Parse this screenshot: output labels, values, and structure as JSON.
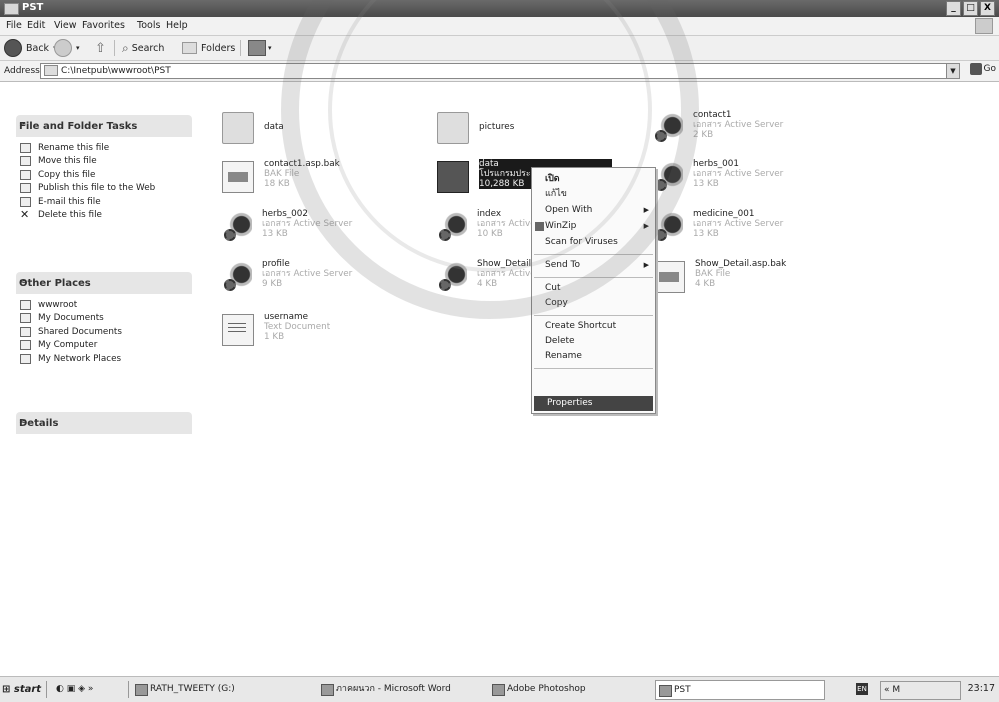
{
  "window": {
    "title": "PST",
    "min_label": "_",
    "max_label": "□",
    "close_label": "X"
  },
  "menubar": {
    "items": [
      "File",
      "Edit",
      "View",
      "Favorites",
      "Tools",
      "Help"
    ]
  },
  "toolbar": {
    "back_label": "Back",
    "search_label": "Search",
    "folders_label": "Folders"
  },
  "address": {
    "label": "Address",
    "value": "C:\\Inetpub\\wwwroot\\PST",
    "go_label": "Go"
  },
  "tasks_panel": {
    "title": "File and Folder Tasks",
    "items": [
      {
        "label": "Rename this file",
        "icon": "rename-icon"
      },
      {
        "label": "Move this file",
        "icon": "move-icon"
      },
      {
        "label": "Copy this file",
        "icon": "copy-icon"
      },
      {
        "label": "Publish this file to the Web",
        "icon": "publish-icon"
      },
      {
        "label": "E-mail this file",
        "icon": "email-icon"
      },
      {
        "label": "Delete this file",
        "icon": "delete-icon"
      }
    ]
  },
  "places_panel": {
    "title": "Other Places",
    "items": [
      {
        "label": "wwwroot",
        "icon": "folder-icon"
      },
      {
        "label": "My Documents",
        "icon": "folder-icon"
      },
      {
        "label": "Shared Documents",
        "icon": "folder-icon"
      },
      {
        "label": "My Computer",
        "icon": "computer-icon"
      },
      {
        "label": "My Network Places",
        "icon": "network-icon"
      }
    ]
  },
  "details_panel": {
    "title": "Details"
  },
  "files": [
    {
      "name": "data",
      "type": "",
      "size": "",
      "icon": "folder"
    },
    {
      "name": "pictures",
      "type": "",
      "size": "",
      "icon": "folder"
    },
    {
      "name": "contact1",
      "type": "เอกสาร Active Server",
      "size": "2 KB",
      "icon": "asp"
    },
    {
      "name": "contact1.asp.bak",
      "type": "BAK File",
      "size": "18 KB",
      "icon": "bak"
    },
    {
      "name": "data",
      "type": "โปรแกรมประยุกต์ Microsoft Ac...",
      "size": "10,288 KB",
      "icon": "mdb"
    },
    {
      "name": "herbs_001",
      "type": "เอกสาร Active Server",
      "size": "13 KB",
      "icon": "asp"
    },
    {
      "name": "herbs_002",
      "type": "เอกสาร Active Server",
      "size": "13 KB",
      "icon": "asp"
    },
    {
      "name": "index",
      "type": "เอกสาร Active",
      "size": "10 KB",
      "icon": "asp"
    },
    {
      "name": "medicine_001",
      "type": "เอกสาร Active Server",
      "size": "13 KB",
      "icon": "asp"
    },
    {
      "name": "profile",
      "type": "เอกสาร Active Server",
      "size": "9 KB",
      "icon": "asp"
    },
    {
      "name": "Show_Detail",
      "type": "เอกสาร Active",
      "size": "4 KB",
      "icon": "asp"
    },
    {
      "name": "Show_Detail.asp.bak",
      "type": "BAK File",
      "size": "4 KB",
      "icon": "bak"
    },
    {
      "name": "username",
      "type": "Text Document",
      "size": "1 KB",
      "icon": "doc"
    }
  ],
  "context_menu": {
    "items": [
      "เปิด",
      "แก้ไข",
      "Open With",
      "WinZip",
      "Scan for Viruses",
      "Send To",
      "Cut",
      "Copy",
      "Create Shortcut",
      "Delete",
      "Rename",
      "Properties"
    ]
  },
  "taskbar": {
    "start_label": "start",
    "chevron_label": "»",
    "drive_label": "RATH_TWEETY (G:)",
    "word_label": "ภาคผนวก - Microsoft Word",
    "photoshop_label": "Adobe Photoshop",
    "explorer_label": "PST",
    "lang_label": "EN",
    "tray_label": "« M",
    "clock": "23:17"
  }
}
